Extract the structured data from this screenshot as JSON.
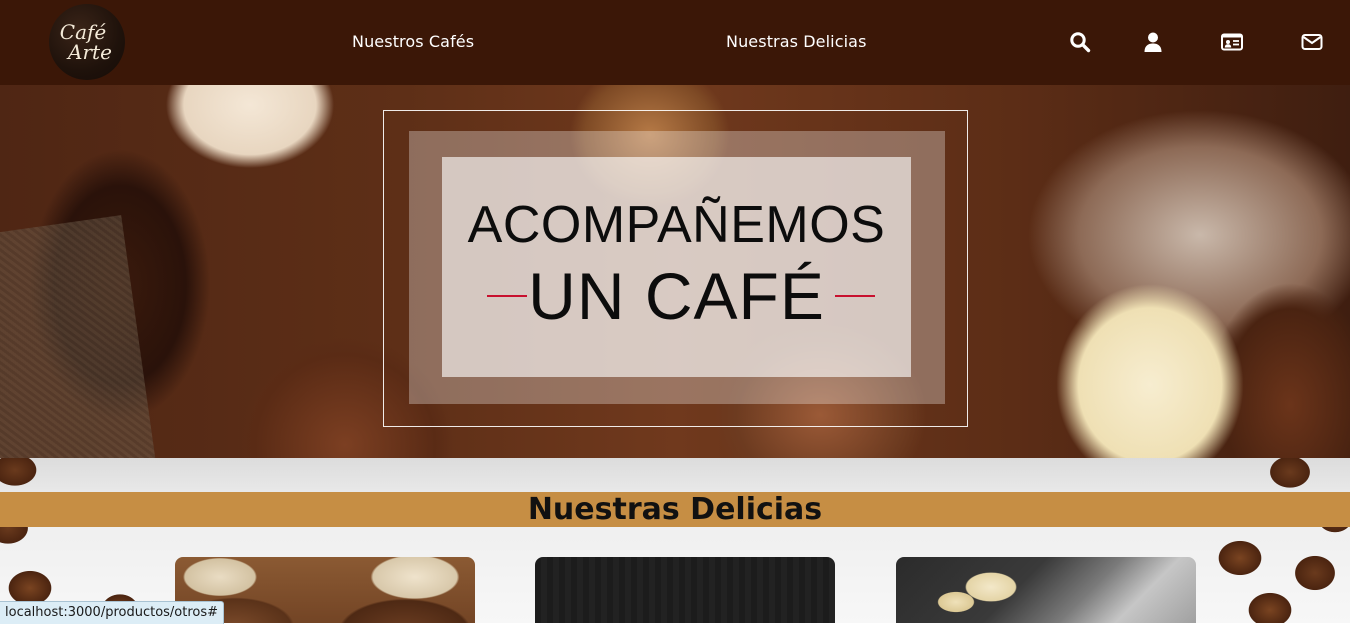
{
  "header": {
    "logo": {
      "line1": "Café",
      "line2": "Arte"
    },
    "nav": {
      "cafes_label": "Nuestros Cafés",
      "delicias_label": "Nuestras Delicias"
    },
    "icons": [
      "search-icon",
      "user-icon",
      "id-card-icon",
      "envelope-icon"
    ]
  },
  "hero": {
    "line1": "ACOMPAÑEMOS",
    "line2": "UN CAFÉ",
    "accent_color": "#c8102e"
  },
  "section": {
    "title": "Nuestras Delicias",
    "band_color": "#c68e44"
  },
  "status_bar": {
    "url": "localhost:3000/productos/otros#"
  },
  "colors": {
    "navbar": "#3b1707"
  }
}
